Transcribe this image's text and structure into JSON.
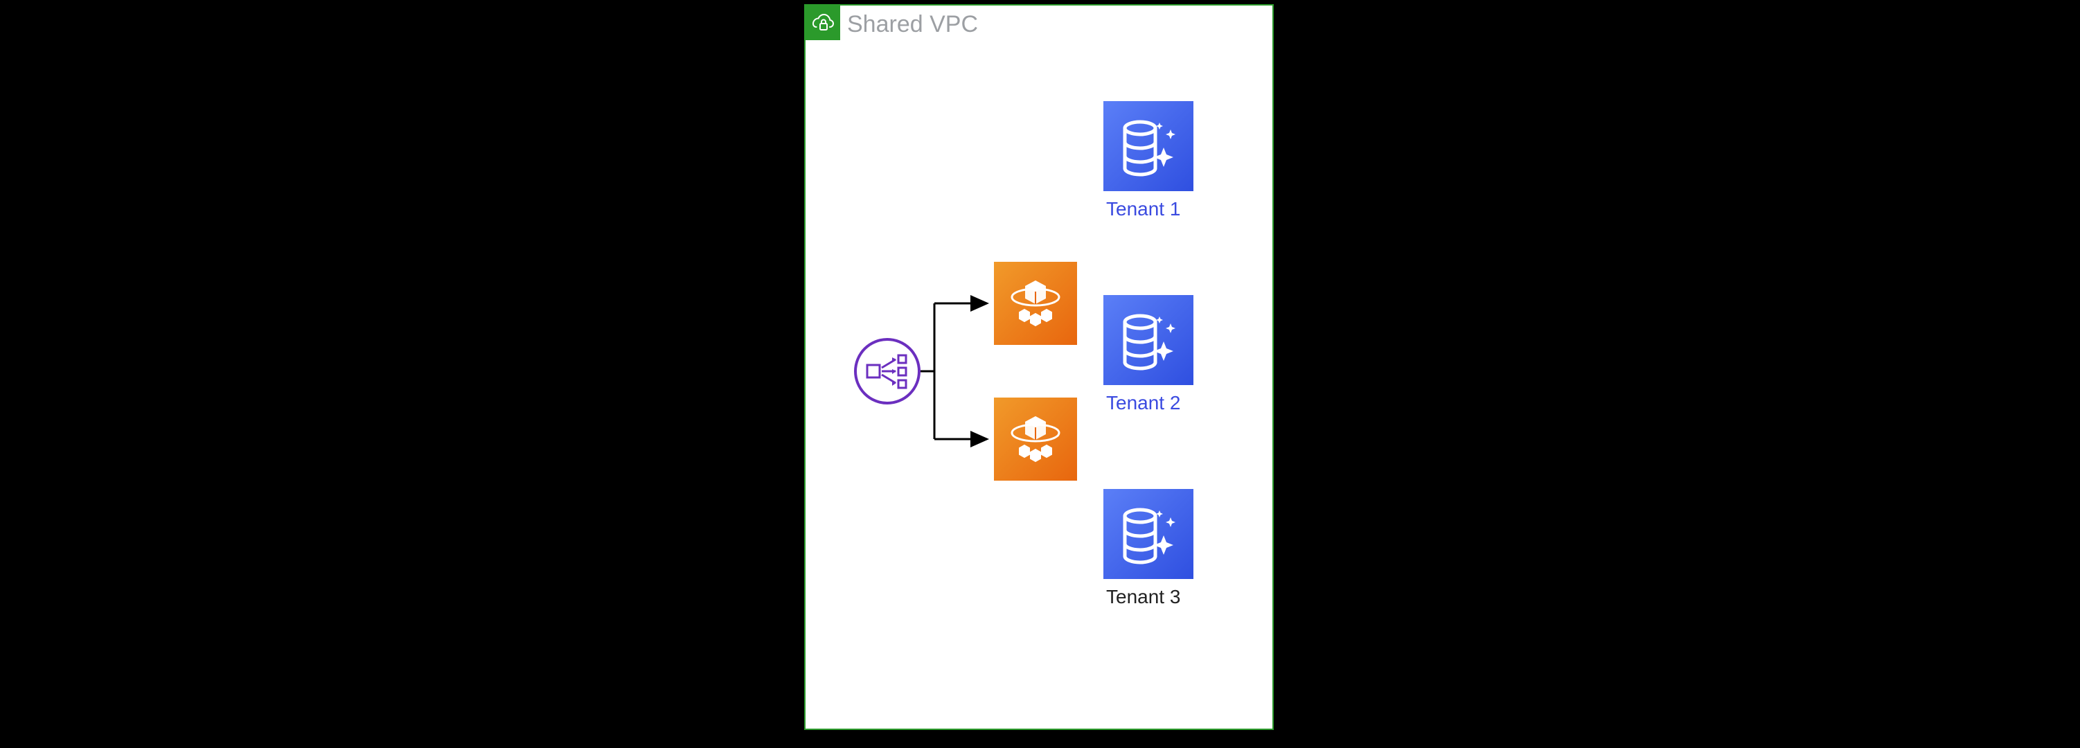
{
  "vpc": {
    "title": "Shared VPC"
  },
  "tenants": [
    {
      "label": "Tenant 1"
    },
    {
      "label": "Tenant 2"
    },
    {
      "label": "Tenant 3"
    }
  ],
  "colors": {
    "vpc_border": "#2b9a2b",
    "router": "#6b2fbf",
    "compute_a": "#f19a2a",
    "compute_b": "#e8660e",
    "db_a": "#5b7ff7",
    "db_b": "#2f4fe0",
    "tenant_label": "#3b4be0"
  }
}
